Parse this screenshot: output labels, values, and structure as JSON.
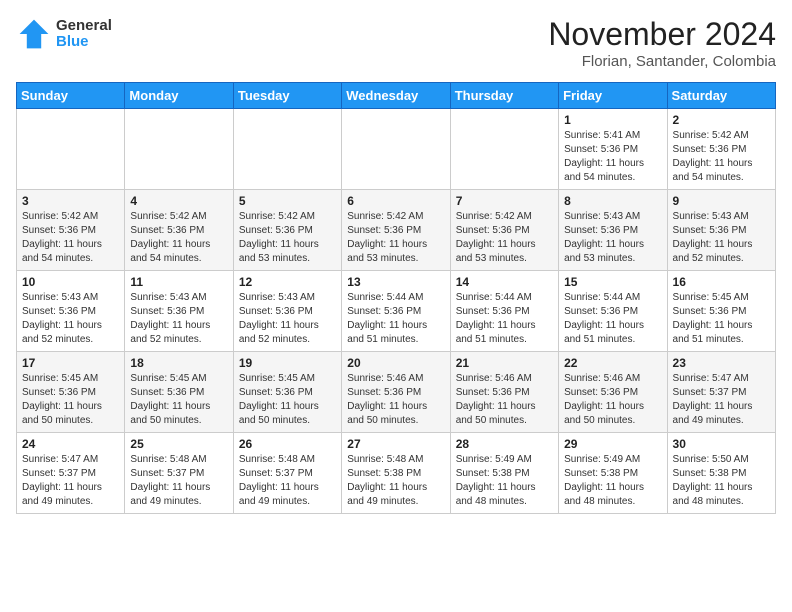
{
  "logo": {
    "general": "General",
    "blue": "Blue"
  },
  "title": {
    "month_year": "November 2024",
    "location": "Florian, Santander, Colombia"
  },
  "days_of_week": [
    "Sunday",
    "Monday",
    "Tuesday",
    "Wednesday",
    "Thursday",
    "Friday",
    "Saturday"
  ],
  "weeks": [
    [
      {
        "day": "",
        "info": ""
      },
      {
        "day": "",
        "info": ""
      },
      {
        "day": "",
        "info": ""
      },
      {
        "day": "",
        "info": ""
      },
      {
        "day": "",
        "info": ""
      },
      {
        "day": "1",
        "info": "Sunrise: 5:41 AM\nSunset: 5:36 PM\nDaylight: 11 hours and 54 minutes."
      },
      {
        "day": "2",
        "info": "Sunrise: 5:42 AM\nSunset: 5:36 PM\nDaylight: 11 hours and 54 minutes."
      }
    ],
    [
      {
        "day": "3",
        "info": "Sunrise: 5:42 AM\nSunset: 5:36 PM\nDaylight: 11 hours and 54 minutes."
      },
      {
        "day": "4",
        "info": "Sunrise: 5:42 AM\nSunset: 5:36 PM\nDaylight: 11 hours and 54 minutes."
      },
      {
        "day": "5",
        "info": "Sunrise: 5:42 AM\nSunset: 5:36 PM\nDaylight: 11 hours and 53 minutes."
      },
      {
        "day": "6",
        "info": "Sunrise: 5:42 AM\nSunset: 5:36 PM\nDaylight: 11 hours and 53 minutes."
      },
      {
        "day": "7",
        "info": "Sunrise: 5:42 AM\nSunset: 5:36 PM\nDaylight: 11 hours and 53 minutes."
      },
      {
        "day": "8",
        "info": "Sunrise: 5:43 AM\nSunset: 5:36 PM\nDaylight: 11 hours and 53 minutes."
      },
      {
        "day": "9",
        "info": "Sunrise: 5:43 AM\nSunset: 5:36 PM\nDaylight: 11 hours and 52 minutes."
      }
    ],
    [
      {
        "day": "10",
        "info": "Sunrise: 5:43 AM\nSunset: 5:36 PM\nDaylight: 11 hours and 52 minutes."
      },
      {
        "day": "11",
        "info": "Sunrise: 5:43 AM\nSunset: 5:36 PM\nDaylight: 11 hours and 52 minutes."
      },
      {
        "day": "12",
        "info": "Sunrise: 5:43 AM\nSunset: 5:36 PM\nDaylight: 11 hours and 52 minutes."
      },
      {
        "day": "13",
        "info": "Sunrise: 5:44 AM\nSunset: 5:36 PM\nDaylight: 11 hours and 51 minutes."
      },
      {
        "day": "14",
        "info": "Sunrise: 5:44 AM\nSunset: 5:36 PM\nDaylight: 11 hours and 51 minutes."
      },
      {
        "day": "15",
        "info": "Sunrise: 5:44 AM\nSunset: 5:36 PM\nDaylight: 11 hours and 51 minutes."
      },
      {
        "day": "16",
        "info": "Sunrise: 5:45 AM\nSunset: 5:36 PM\nDaylight: 11 hours and 51 minutes."
      }
    ],
    [
      {
        "day": "17",
        "info": "Sunrise: 5:45 AM\nSunset: 5:36 PM\nDaylight: 11 hours and 50 minutes."
      },
      {
        "day": "18",
        "info": "Sunrise: 5:45 AM\nSunset: 5:36 PM\nDaylight: 11 hours and 50 minutes."
      },
      {
        "day": "19",
        "info": "Sunrise: 5:45 AM\nSunset: 5:36 PM\nDaylight: 11 hours and 50 minutes."
      },
      {
        "day": "20",
        "info": "Sunrise: 5:46 AM\nSunset: 5:36 PM\nDaylight: 11 hours and 50 minutes."
      },
      {
        "day": "21",
        "info": "Sunrise: 5:46 AM\nSunset: 5:36 PM\nDaylight: 11 hours and 50 minutes."
      },
      {
        "day": "22",
        "info": "Sunrise: 5:46 AM\nSunset: 5:36 PM\nDaylight: 11 hours and 50 minutes."
      },
      {
        "day": "23",
        "info": "Sunrise: 5:47 AM\nSunset: 5:37 PM\nDaylight: 11 hours and 49 minutes."
      }
    ],
    [
      {
        "day": "24",
        "info": "Sunrise: 5:47 AM\nSunset: 5:37 PM\nDaylight: 11 hours and 49 minutes."
      },
      {
        "day": "25",
        "info": "Sunrise: 5:48 AM\nSunset: 5:37 PM\nDaylight: 11 hours and 49 minutes."
      },
      {
        "day": "26",
        "info": "Sunrise: 5:48 AM\nSunset: 5:37 PM\nDaylight: 11 hours and 49 minutes."
      },
      {
        "day": "27",
        "info": "Sunrise: 5:48 AM\nSunset: 5:38 PM\nDaylight: 11 hours and 49 minutes."
      },
      {
        "day": "28",
        "info": "Sunrise: 5:49 AM\nSunset: 5:38 PM\nDaylight: 11 hours and 48 minutes."
      },
      {
        "day": "29",
        "info": "Sunrise: 5:49 AM\nSunset: 5:38 PM\nDaylight: 11 hours and 48 minutes."
      },
      {
        "day": "30",
        "info": "Sunrise: 5:50 AM\nSunset: 5:38 PM\nDaylight: 11 hours and 48 minutes."
      }
    ]
  ]
}
